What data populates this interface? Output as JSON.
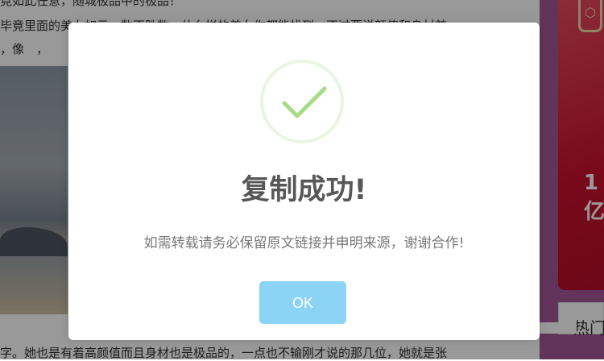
{
  "background": {
    "article_lines": [
      "竟如此任意，随城极品中的极品！",
      "毕竟里面的美女如云，数不胜数，什么样的美女你都能找到，不过要说颜值和身材兼",
      "，像　，",
      "字。她也是有着高颜值而且身材也是极品的，一点也不输刚才说的那几位，她就是张"
    ],
    "promo_text": "1亿",
    "hot_title": "热门",
    "promo_badge_icon": "hexagon-logo-icon"
  },
  "dialog": {
    "icon": "success-checkmark-icon",
    "title": "复制成功!",
    "message": "如需转载请务必保留原文链接并申明来源，谢谢合作!",
    "ok_label": "OK"
  },
  "colors": {
    "checkmark": "#a5dc86",
    "ok_button": "#8cd4f5",
    "overlay": "rgba(0,0,0,0.4)",
    "sidebar": "#a3589a",
    "promo": "#c8102e"
  }
}
